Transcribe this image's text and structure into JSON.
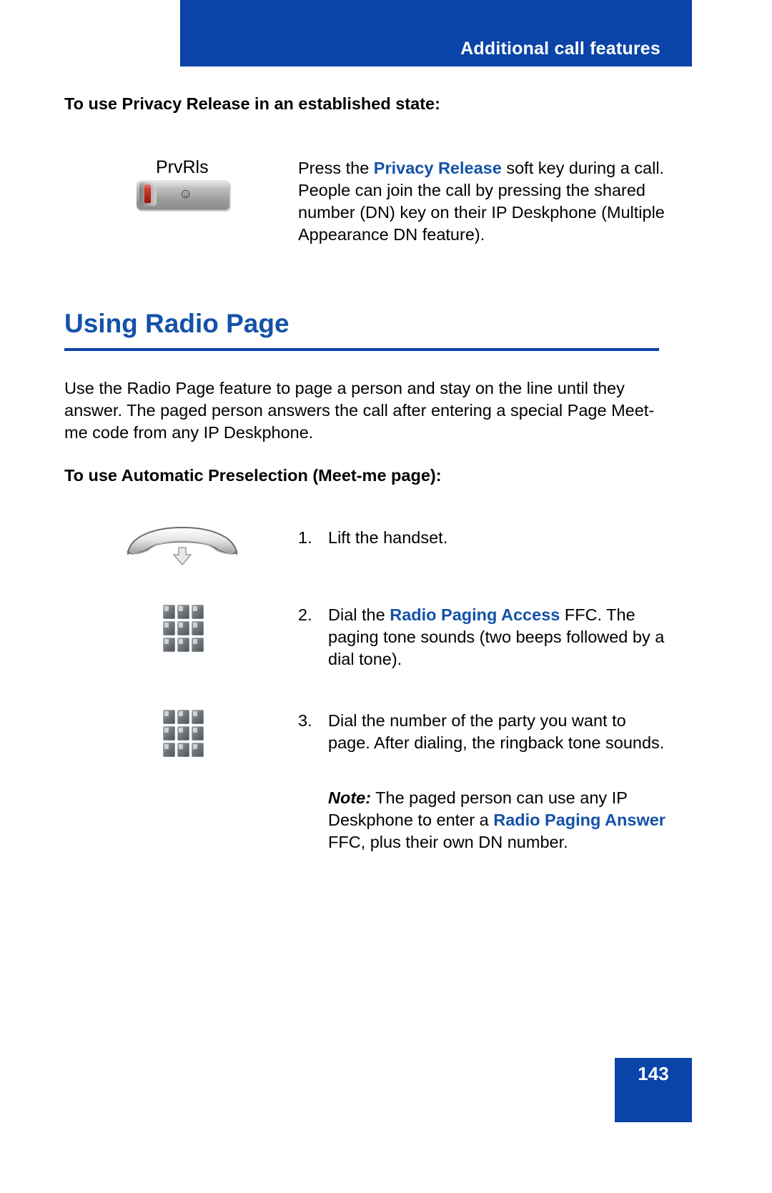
{
  "header": {
    "title": "Additional call features",
    "band_color": "#0a44a8"
  },
  "procedures": {
    "privacy_release_heading": "To use Privacy Release in an established state:",
    "privacy_release": {
      "softkey_label": "PrvRls",
      "icon_name": "privacy-release-soft-key",
      "text_before": "Press the ",
      "text_bold": "Privacy Release",
      "text_after": " soft key during a call. People can join the call by pressing the shared number (DN) key on their IP Deskphone (Multiple Appearance DN feature)."
    }
  },
  "section": {
    "title": "Using Radio Page",
    "title_color": "#1452a8",
    "intro": "Use the Radio Page feature to page a person and stay on the line until they answer. The paged person answers the call after entering a special Page Meet-me code from any IP Deskphone.",
    "steps_heading": "To use Automatic Preselection (Meet-me page):",
    "steps": [
      {
        "number": "1.",
        "icon_name": "lift-handset-icon",
        "text_before": "Lift the handset.",
        "text_bold": "",
        "text_after": ""
      },
      {
        "number": "2.",
        "icon_name": "dialpad-icon",
        "text_before": "Dial the ",
        "text_bold": "Radio Paging Access",
        "text_after": " FFC. The paging tone sounds (two beeps followed by a dial tone)."
      },
      {
        "number": "3.",
        "icon_name": "dialpad-icon",
        "text_before": "Dial the number of the party you want to page. After dialing, the ringback tone sounds.",
        "text_bold": "",
        "text_after": ""
      }
    ],
    "note": {
      "label": "Note:",
      "text_before": " The paged person can use any IP Deskphone to enter a ",
      "text_bold": "Radio Paging Answer",
      "text_after": " FFC, plus their own DN number."
    }
  },
  "footer": {
    "page_number": "143",
    "band_color": "#0a44a8"
  }
}
